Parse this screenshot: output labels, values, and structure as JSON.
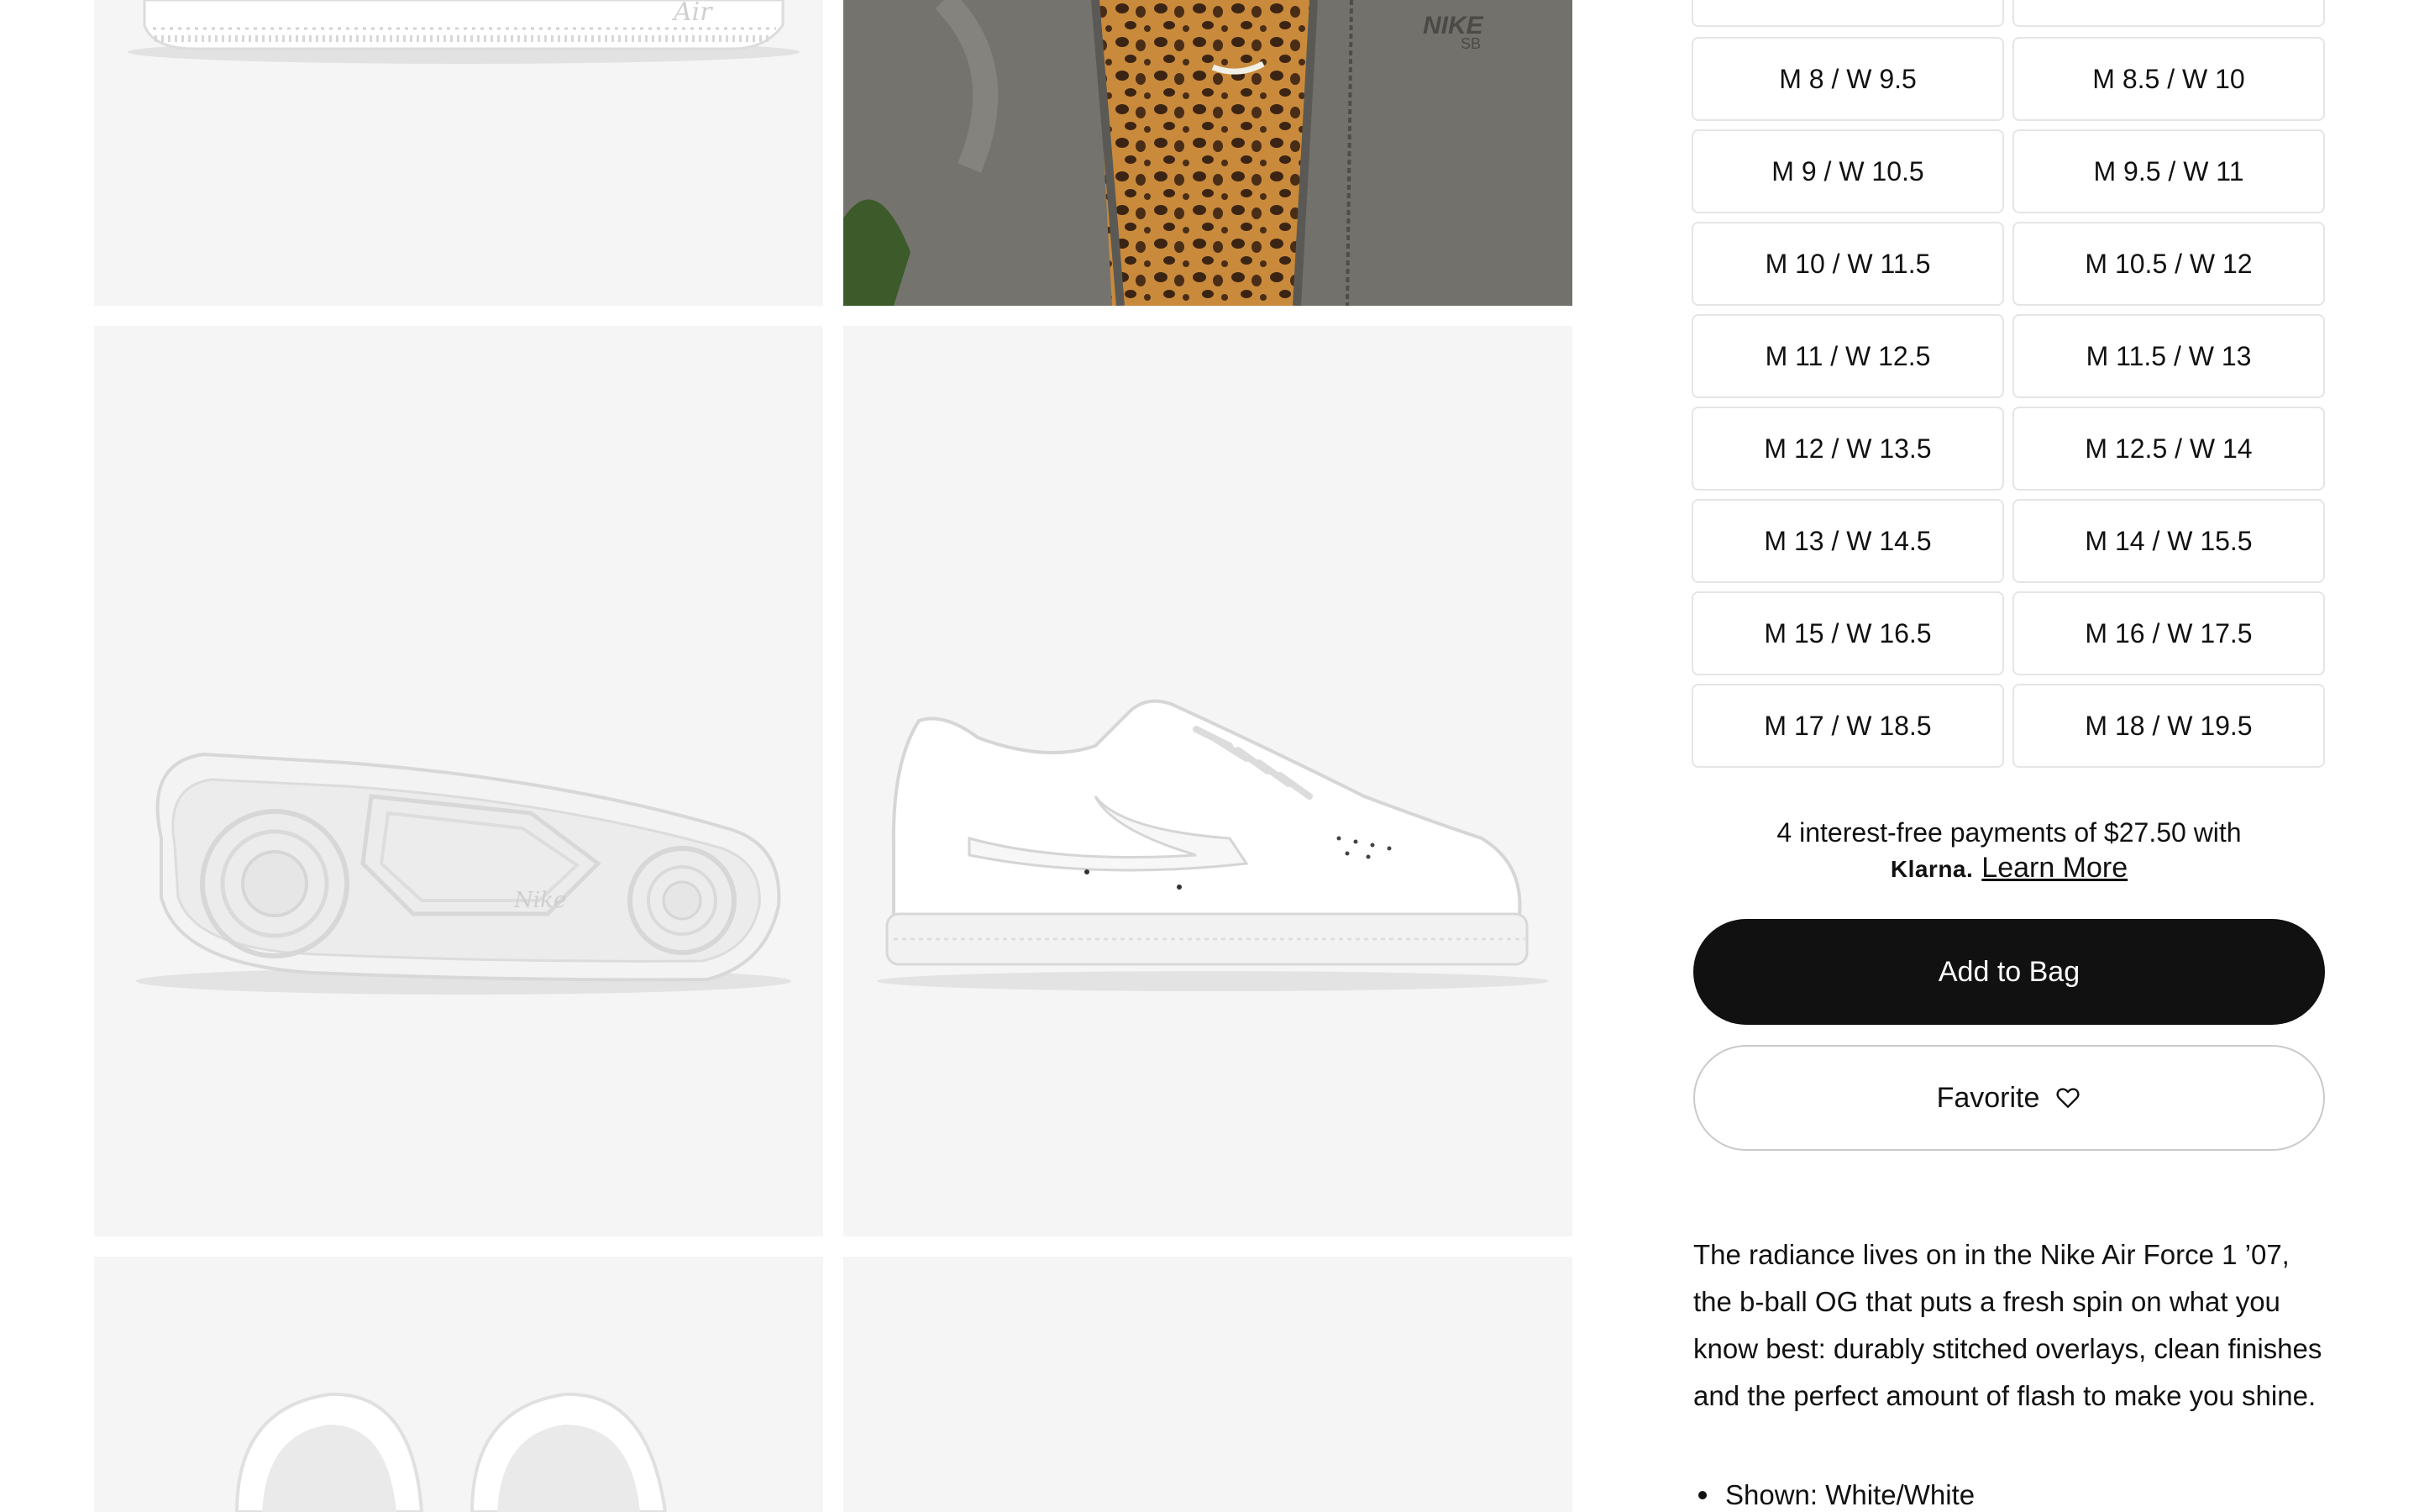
{
  "gallery": {
    "images": [
      {
        "name": "air-force-1-sole-side-view"
      },
      {
        "name": "model-wearing-jacket"
      },
      {
        "name": "air-force-1-outsole-view"
      },
      {
        "name": "air-force-1-lateral-side-view"
      },
      {
        "name": "air-force-1-top-view"
      },
      {
        "name": "air-force-1-extra-view"
      }
    ]
  },
  "sizes": [
    "M 8 / W 9.5",
    "M 8.5 / W 10",
    "M 9 / W 10.5",
    "M 9.5 / W 11",
    "M 10 / W 11.5",
    "M 10.5 / W 12",
    "M 11 / W 12.5",
    "M 11.5 / W 13",
    "M 12 / W 13.5",
    "M 12.5 / W 14",
    "M 13 / W 14.5",
    "M 14 / W 15.5",
    "M 15 / W 16.5",
    "M 16 / W 17.5",
    "M 17 / W 18.5",
    "M 18 / W 19.5"
  ],
  "klarna": {
    "text": "4 interest-free payments of $27.50 with",
    "logo": "Klarna.",
    "link": "Learn More"
  },
  "actions": {
    "add_to_bag": "Add to Bag",
    "favorite": "Favorite"
  },
  "description": {
    "text": "The radiance lives on in the Nike Air Force 1 ’07, the b-ball OG that puts a fresh spin on what you know best: durably stitched overlays, clean finishes and the perfect amount of flash to make you shine.",
    "bullets": [
      "Shown: White/White"
    ]
  },
  "colors": {
    "primary_button": "#111111",
    "tile_background": "#f5f5f5",
    "border": "#e5e5e5"
  }
}
